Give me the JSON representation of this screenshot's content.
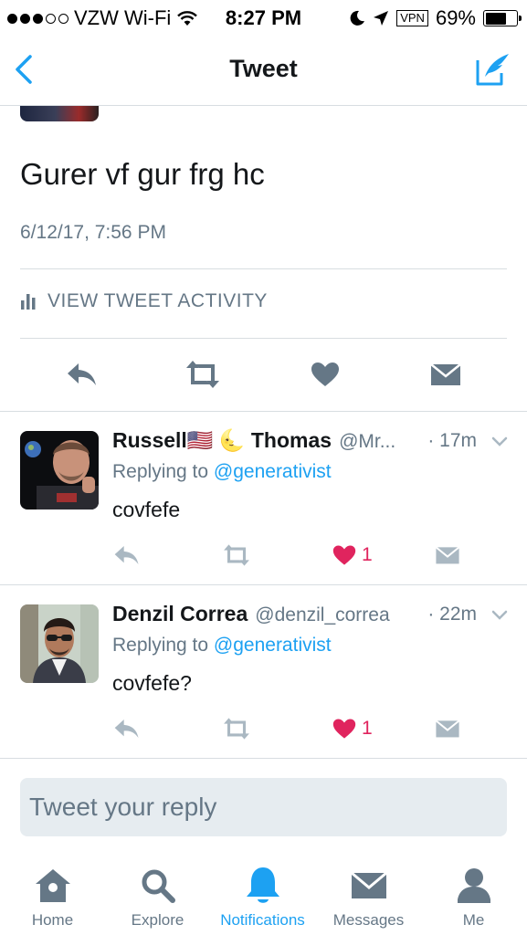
{
  "status_bar": {
    "carrier": "VZW Wi-Fi",
    "time": "8:27 PM",
    "vpn": "VPN",
    "battery": "69%",
    "battery_level": 0.69
  },
  "nav": {
    "title": "Tweet",
    "back_icon": "chevron-left-icon",
    "compose_icon": "compose-tweet-icon"
  },
  "tweet": {
    "text": "Gurer vf gur frg hc",
    "timestamp": "6/12/17, 7:56 PM",
    "activity_label": "VIEW TWEET ACTIVITY"
  },
  "replies": [
    {
      "name": "Russell🇺🇸 🌜 Thomas",
      "handle": "@Mr...",
      "time": "· 17m",
      "replying_prefix": "Replying to",
      "replying_to": "@generativist",
      "text": "covfefe",
      "like_count": "1"
    },
    {
      "name": "Denzil Correa",
      "handle": "@denzil_correa",
      "time": "· 22m",
      "replying_prefix": "Replying to",
      "replying_to": "@generativist",
      "text": "covfefe?",
      "like_count": "1"
    }
  ],
  "composer": {
    "placeholder": "Tweet your reply"
  },
  "tabs": [
    {
      "label": "Home",
      "icon": "home-icon"
    },
    {
      "label": "Explore",
      "icon": "search-icon"
    },
    {
      "label": "Notifications",
      "icon": "bell-icon",
      "active": true
    },
    {
      "label": "Messages",
      "icon": "envelope-icon"
    },
    {
      "label": "Me",
      "icon": "person-icon"
    }
  ],
  "colors": {
    "accent": "#1da1f2",
    "gray": "#657786",
    "like": "#e0245e",
    "action_dark": "#657786",
    "divider": "#d8dde1"
  }
}
